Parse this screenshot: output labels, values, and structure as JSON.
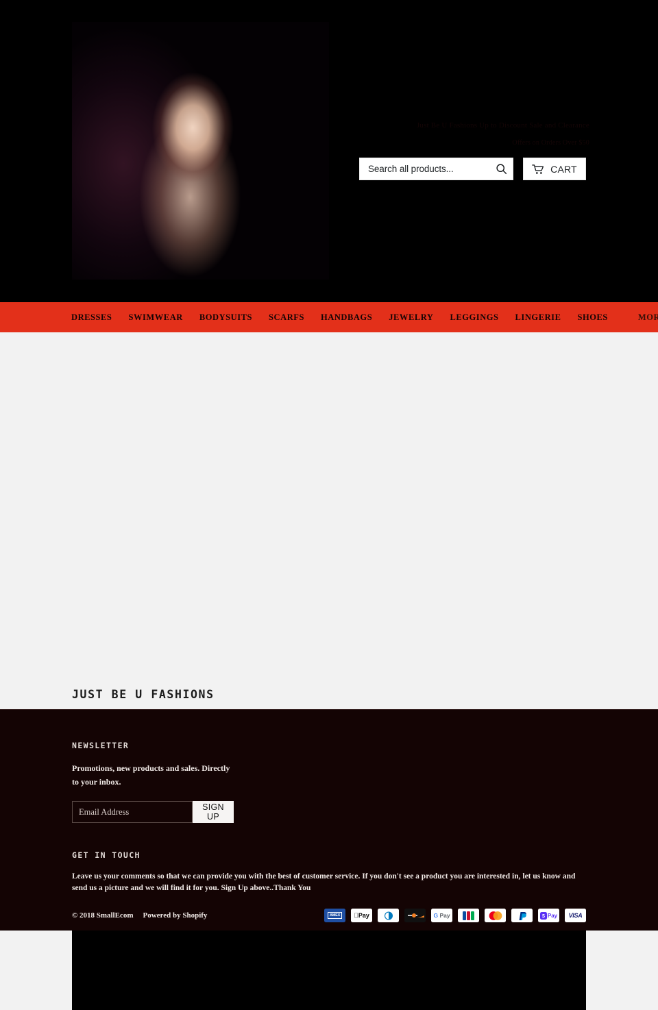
{
  "header": {
    "announcement_line1": "Just Be U Fashions Up to Discount Sale and Clearance",
    "announcement_line2": "Offers on Orders Over $50",
    "logo_alt": "Just Be U Fashions logo",
    "search": {
      "placeholder": "Search all products...",
      "value": "",
      "submit_icon": "search-icon"
    },
    "cart": {
      "label": "CART",
      "icon": "shopping-cart-icon"
    }
  },
  "nav": {
    "items": [
      {
        "label": "DRESSES"
      },
      {
        "label": "SWIMWEAR"
      },
      {
        "label": "BODYSUITS"
      },
      {
        "label": "SCARFS"
      },
      {
        "label": "HANDBAGS"
      },
      {
        "label": "JEWELRY"
      },
      {
        "label": "LEGGINGS"
      },
      {
        "label": "LINGERIE"
      },
      {
        "label": "SHOES"
      }
    ],
    "more": {
      "label": "MORE",
      "icon": "chevron-down-icon"
    },
    "background_color": "#e3301a"
  },
  "main": {
    "page_title": "JUST BE U FASHIONS",
    "media_block_color": "#000000",
    "background_color": "#f2f2f2"
  },
  "footer": {
    "background_color": "#140404",
    "newsletter": {
      "heading": "NEWSLETTER",
      "description": "Promotions, new products and sales. Directly to your inbox.",
      "email_placeholder": "Email Address",
      "email_value": "",
      "signup_label": "SIGN UP"
    },
    "get_in_touch": {
      "heading": "GET IN TOUCH",
      "text": "Leave us your comments so that we can provide you with the best of customer service.  If you don't see a product you are interested in, let us know and send us a picture and we will find it for you.  Sign Up above..Thank You"
    },
    "bottom": {
      "copyright": "© 2018 SmallEcom",
      "powered_by": "Powered by Shopify",
      "payment_methods": [
        {
          "name": "american-express",
          "label": "AMEX"
        },
        {
          "name": "apple-pay",
          "label": "Pay"
        },
        {
          "name": "diners-club",
          "label": "Diners"
        },
        {
          "name": "discover",
          "label": "Discover"
        },
        {
          "name": "google-pay",
          "label": "Pay"
        },
        {
          "name": "jcb",
          "label": "JCB"
        },
        {
          "name": "mastercard",
          "label": "Mastercard"
        },
        {
          "name": "paypal",
          "label": "PayPal"
        },
        {
          "name": "shop-pay",
          "label": "Pay"
        },
        {
          "name": "visa",
          "label": "VISA"
        }
      ]
    }
  }
}
